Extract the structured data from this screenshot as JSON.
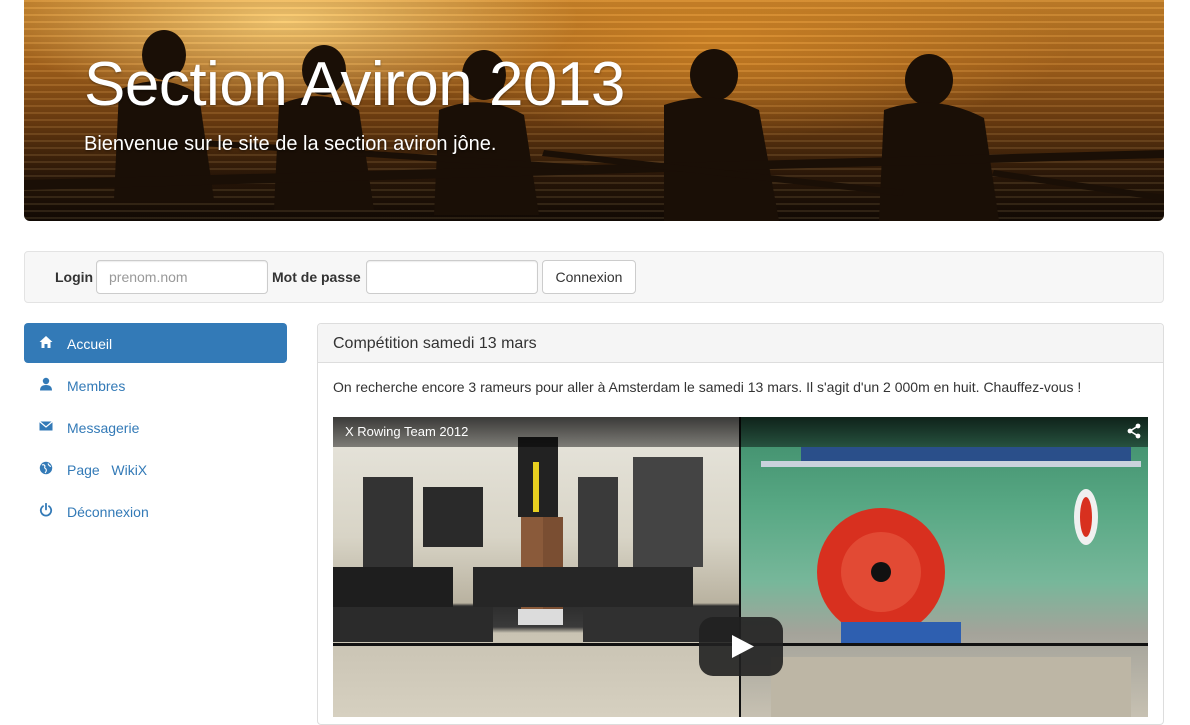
{
  "hero": {
    "title": "Section Aviron 2013",
    "subtitle": "Bienvenue sur le site de la section aviron jône."
  },
  "login": {
    "login_label": "Login",
    "login_placeholder": "prenom.nom",
    "login_value": "",
    "password_label": "Mot de passe",
    "password_value": "",
    "submit_label": "Connexion"
  },
  "sidebar": {
    "items": [
      {
        "label": "Accueil",
        "icon": "home-icon",
        "active": true
      },
      {
        "label": "Membres",
        "icon": "user-icon",
        "active": false
      },
      {
        "label": "Messagerie",
        "icon": "envelope-icon",
        "active": false
      },
      {
        "label": "Page   WikiX",
        "icon": "globe-icon",
        "active": false
      },
      {
        "label": "Déconnexion",
        "icon": "power-icon",
        "active": false
      }
    ]
  },
  "article": {
    "title": "Compétition samedi 13 mars",
    "text": "On recherche encore 3 rameurs pour aller à Amsterdam le samedi 13 mars. Il s'agit d'un 2 000m en huit. Chauffez-vous !",
    "video_title": "X Rowing Team 2012"
  },
  "colors": {
    "accent": "#337ab7",
    "panel_heading_bg": "#f5f5f5",
    "login_bar_bg": "#f7f7f7"
  }
}
